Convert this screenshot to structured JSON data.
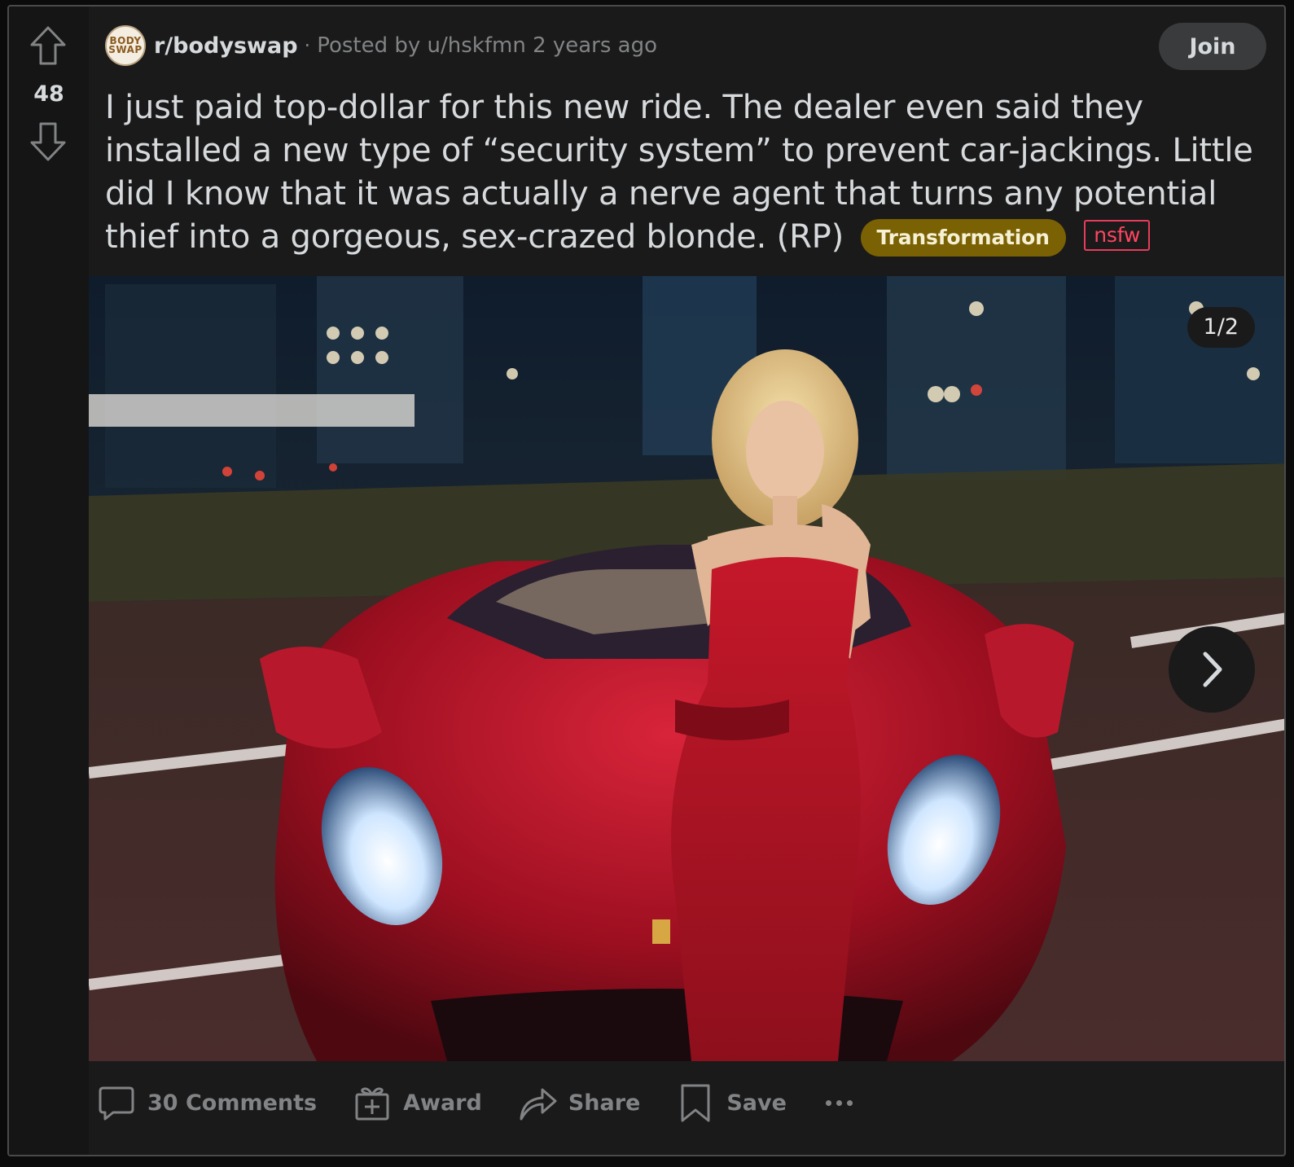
{
  "vote": {
    "count": "48"
  },
  "subreddit": {
    "avatar_line1": "BODY",
    "avatar_line2": "SWAP",
    "name": "r/bodyswap",
    "separator": "·",
    "posted_prefix": "Posted by",
    "author": "u/hskfmn",
    "age": "2 years ago"
  },
  "join_label": "Join",
  "post": {
    "title": "I just paid top-dollar for this new ride. The dealer even said they installed a new type of “security system” to prevent car-jackings. Little did I know that it was actually a nerve agent that turns any potential thief into a gorgeous, sex-crazed blonde. (RP)",
    "flair": "Transformation",
    "nsfw_tag": "nsfw"
  },
  "gallery": {
    "counter": "1/2"
  },
  "actions": {
    "comments": "30 Comments",
    "award": "Award",
    "share": "Share",
    "save": "Save"
  },
  "colors": {
    "background": "#1a1a1b",
    "flair": "#7a6103",
    "nsfw": "#ff4561",
    "muted_text": "#818384"
  },
  "icons": [
    "upvote-icon",
    "downvote-icon",
    "chevron-right-icon",
    "comment-icon",
    "award-icon",
    "share-icon",
    "save-icon",
    "more-icon"
  ]
}
